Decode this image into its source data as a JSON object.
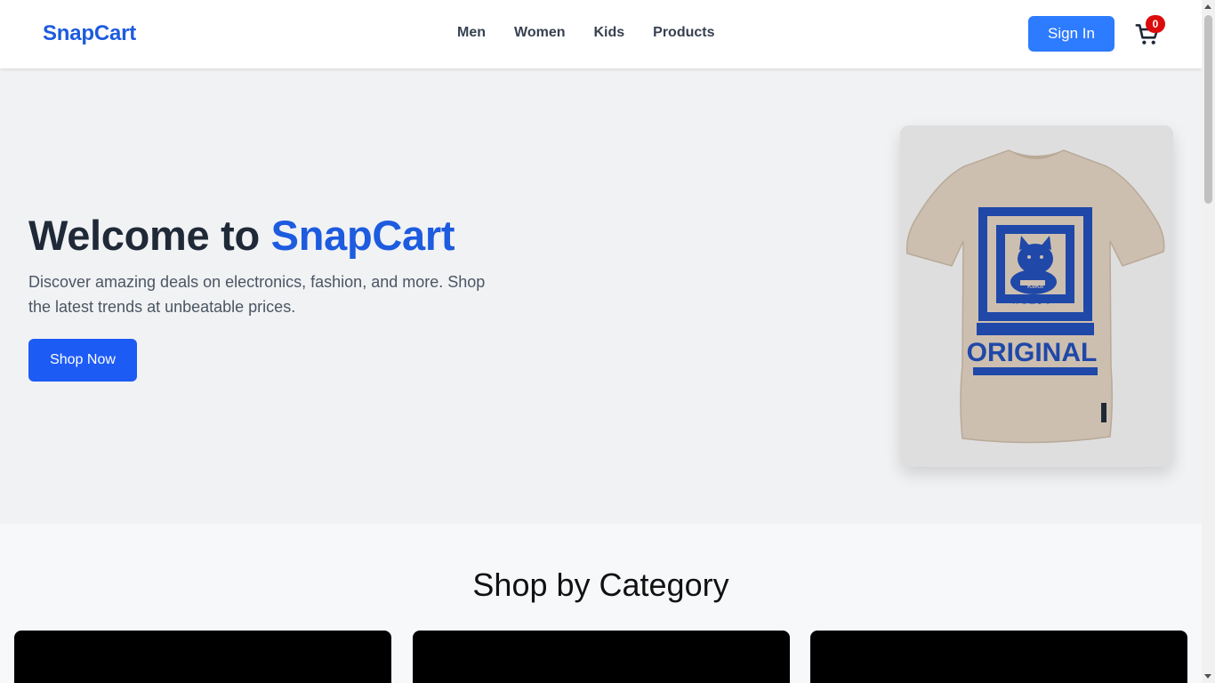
{
  "header": {
    "logo": "SnapCart",
    "nav": [
      "Men",
      "Women",
      "Kids",
      "Products"
    ],
    "sign_in_label": "Sign In",
    "cart_count": "0"
  },
  "hero": {
    "title_prefix": "Welcome to ",
    "title_brand": "SnapCart",
    "description": "Discover amazing deals on electronics, fashion, and more. Shop the latest trends at unbeatable prices.",
    "cta_label": "Shop Now",
    "product_image": {
      "icon": "tshirt-image",
      "shirt_text": "ORIGINAL",
      "shirt_small_text": "KIIKII",
      "shirt_jp_text": "神を信じる"
    }
  },
  "categories": {
    "title": "Shop by Category"
  },
  "colors": {
    "brand": "#1d5bdf",
    "button": "#2d7bff",
    "badge": "#dc0c0c"
  }
}
